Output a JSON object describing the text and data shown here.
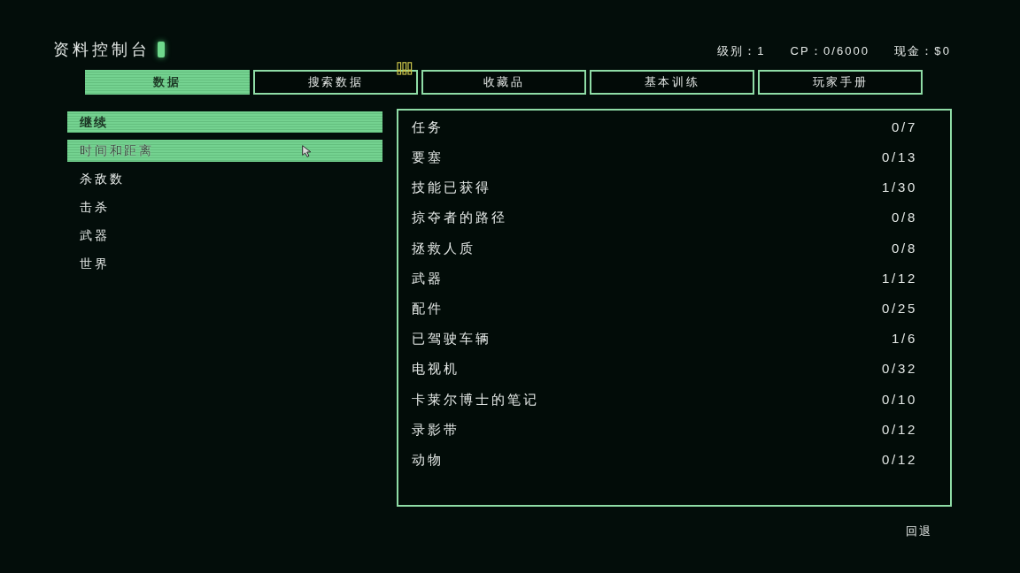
{
  "console": {
    "title": "资料控制台"
  },
  "stats": [
    "级别：1",
    "CP：0/6000",
    "现金：$0"
  ],
  "tabs": [
    {
      "label": "数据",
      "selected": true,
      "alert": false
    },
    {
      "label": "搜索数据",
      "selected": false,
      "alert": true
    },
    {
      "label": "收藏品",
      "selected": false,
      "alert": false
    },
    {
      "label": "基本训练",
      "selected": false,
      "alert": false
    },
    {
      "label": "玩家手册",
      "selected": false,
      "alert": false
    }
  ],
  "sidebar": {
    "heading": "继续",
    "items": [
      {
        "label": "时间和距离",
        "selected": true
      },
      {
        "label": "杀敌数",
        "selected": false
      },
      {
        "label": "击杀",
        "selected": false
      },
      {
        "label": "武器",
        "selected": false
      },
      {
        "label": "世界",
        "selected": false
      }
    ]
  },
  "stats_panel": {
    "rows": [
      {
        "label": "任务",
        "value": "0/7"
      },
      {
        "label": "要塞",
        "value": "0/13"
      },
      {
        "label": "技能已获得",
        "value": "1/30"
      },
      {
        "label": "掠夺者的路径",
        "value": "0/8"
      },
      {
        "label": "拯救人质",
        "value": "0/8"
      },
      {
        "label": "武器",
        "value": "1/12"
      },
      {
        "label": "配件",
        "value": "0/25"
      },
      {
        "label": "已驾驶车辆",
        "value": "1/6"
      },
      {
        "label": "电视机",
        "value": "0/32"
      },
      {
        "label": "卡莱尔博士的笔记",
        "value": "0/10"
      },
      {
        "label": "录影带",
        "value": "0/12"
      },
      {
        "label": "动物",
        "value": "0/12"
      }
    ]
  },
  "footer": {
    "back_hint": "回退"
  }
}
